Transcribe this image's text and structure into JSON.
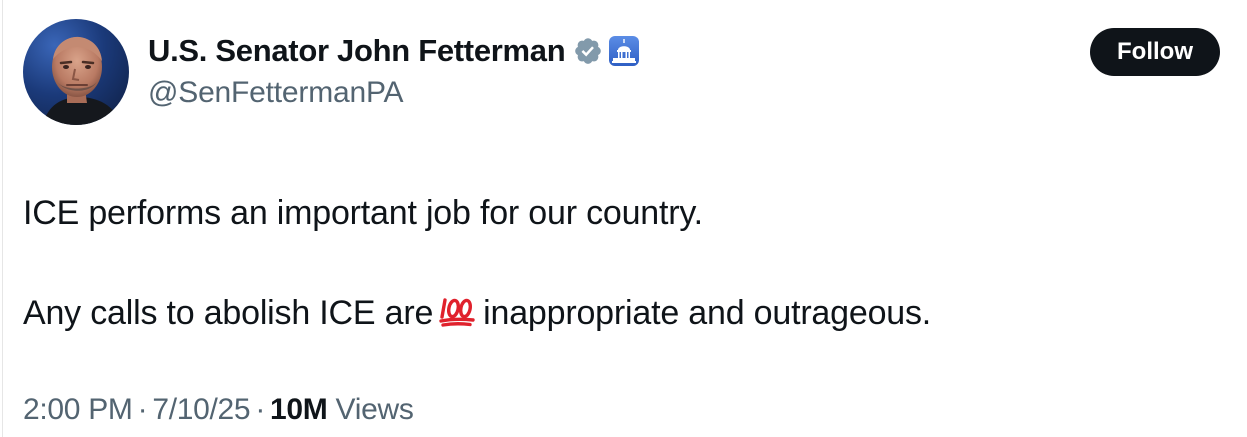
{
  "author": {
    "display_name": "U.S. Senator John Fetterman",
    "handle": "@SenFettermanPA",
    "verified_icon": "verified-badge-icon",
    "affiliation_icon": "capitol-building-icon"
  },
  "follow_label": "Follow",
  "tweet": {
    "line1": "ICE performs an important job for our country.",
    "line2_before": "Any calls to abolish ICE are",
    "emoji_icon": "hundred-points-icon",
    "line2_after": "inappropriate and outrageous."
  },
  "meta": {
    "time": "2:00 PM",
    "separator": "·",
    "date": "7/10/25",
    "views_count": "10M",
    "views_label": "Views"
  },
  "colors": {
    "text_primary": "#0f1419",
    "text_secondary": "#536471",
    "button_bg": "#0f1419",
    "button_text": "#ffffff",
    "verified_grey": "#829aab",
    "emoji_red": "#e0212c"
  }
}
